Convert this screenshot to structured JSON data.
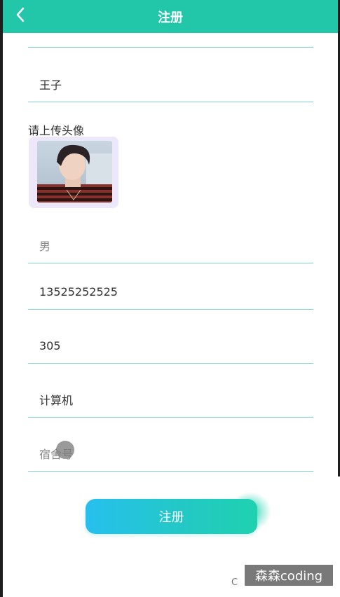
{
  "header": {
    "title": "注册",
    "back_icon": "chevron-left-icon",
    "background": "#22c7a9"
  },
  "form": {
    "name_value": "王子",
    "avatar_label": "请上传头像",
    "gender_placeholder": "男",
    "phone_value": "13525252525",
    "room_value": "305",
    "major_value": "计算机",
    "dorm_placeholder": "宿舍号",
    "submit_label": "注册"
  },
  "footer": {
    "partial_text": "C",
    "watermark": "森森coding"
  },
  "colors": {
    "accent": "#22c7a9",
    "underline": "#7fd4cf",
    "button_start": "#27c0ef",
    "button_end": "#1fd1b0"
  }
}
